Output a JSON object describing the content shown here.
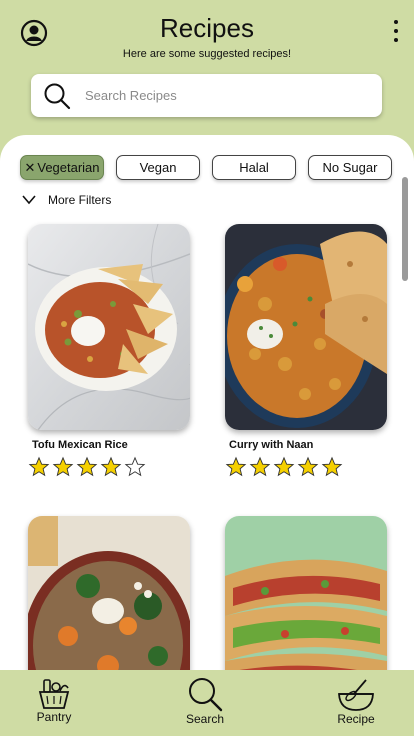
{
  "header": {
    "title": "Recipes",
    "subtitle": "Here are some suggested recipes!",
    "profile_icon": "user-circle-icon",
    "menu_icon": "kebab-menu-icon"
  },
  "search": {
    "placeholder": "Search Recipes",
    "value": ""
  },
  "filters": {
    "chips": [
      {
        "label": "Vegetarian",
        "active": true
      },
      {
        "label": "Vegan",
        "active": false
      },
      {
        "label": "Halal",
        "active": false
      },
      {
        "label": "No Sugar",
        "active": false
      }
    ],
    "more_label": "More Filters"
  },
  "recipes": [
    {
      "name": "Tofu Mexican Rice",
      "rating": 4,
      "image": "tofu-mexican-rice-image"
    },
    {
      "name": "Curry with Naan",
      "rating": 5,
      "image": "curry-with-naan-image"
    },
    {
      "name": "",
      "rating": null,
      "image": "roasted-vegetable-grain-bowl-image"
    },
    {
      "name": "",
      "rating": null,
      "image": "stacked-pita-wraps-image"
    }
  ],
  "nav": {
    "items": [
      {
        "label": "Pantry",
        "icon": "pantry-basket-icon"
      },
      {
        "label": "Search",
        "icon": "search-icon"
      },
      {
        "label": "Recipe",
        "icon": "mixing-bowl-whisk-icon"
      }
    ]
  },
  "colors": {
    "background": "#cfdca4",
    "active_chip": "#8aa56d",
    "star": "#f5d000"
  }
}
